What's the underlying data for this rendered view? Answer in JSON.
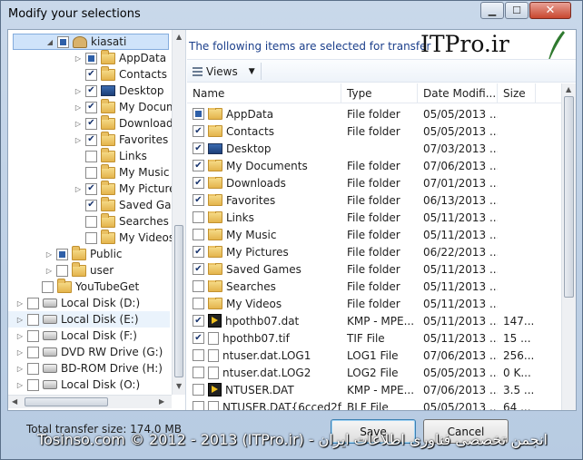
{
  "window": {
    "title": "Modify your selections"
  },
  "tree": {
    "items": [
      {
        "label": "kiasati",
        "check": "partial",
        "icon": "user",
        "arrow": "open",
        "indent": 1,
        "selected": true
      },
      {
        "label": "AppData",
        "check": "partial",
        "icon": "folder",
        "arrow": "closed",
        "indent": 2
      },
      {
        "label": "Contacts",
        "check": "checked",
        "icon": "folder",
        "arrow": "none",
        "indent": 2
      },
      {
        "label": "Desktop",
        "check": "checked",
        "icon": "monitor",
        "arrow": "closed",
        "indent": 2
      },
      {
        "label": "My Documents",
        "check": "checked",
        "icon": "folder",
        "arrow": "closed",
        "indent": 2
      },
      {
        "label": "Downloads",
        "check": "checked",
        "icon": "folder",
        "arrow": "closed",
        "indent": 2
      },
      {
        "label": "Favorites",
        "check": "checked",
        "icon": "folder",
        "arrow": "closed",
        "indent": 2
      },
      {
        "label": "Links",
        "check": "unchecked",
        "icon": "folder",
        "arrow": "none",
        "indent": 2
      },
      {
        "label": "My Music",
        "check": "unchecked",
        "icon": "folder",
        "arrow": "none",
        "indent": 2
      },
      {
        "label": "My Pictures",
        "check": "checked",
        "icon": "folder",
        "arrow": "closed",
        "indent": 2
      },
      {
        "label": "Saved Games",
        "check": "checked",
        "icon": "folder",
        "arrow": "none",
        "indent": 2
      },
      {
        "label": "Searches",
        "check": "unchecked",
        "icon": "folder",
        "arrow": "none",
        "indent": 2
      },
      {
        "label": "My Videos",
        "check": "unchecked",
        "icon": "folder",
        "arrow": "none",
        "indent": 2
      },
      {
        "label": "Public",
        "check": "partial",
        "icon": "folder",
        "arrow": "closed",
        "indent": 1
      },
      {
        "label": "user",
        "check": "unchecked",
        "icon": "folder",
        "arrow": "closed",
        "indent": 1
      },
      {
        "label": "YouTubeGet",
        "check": "unchecked",
        "icon": "folder",
        "arrow": "none",
        "indent": 0.5
      },
      {
        "label": "Local Disk (D:)",
        "check": "unchecked",
        "icon": "drive",
        "arrow": "closed",
        "indent": 0
      },
      {
        "label": "Local Disk (E:)",
        "check": "unchecked",
        "icon": "drive",
        "arrow": "closed",
        "indent": 0,
        "hover": true
      },
      {
        "label": "Local Disk (F:)",
        "check": "unchecked",
        "icon": "drive",
        "arrow": "closed",
        "indent": 0
      },
      {
        "label": "DVD RW Drive (G:)",
        "check": "unchecked",
        "icon": "drive",
        "arrow": "closed",
        "indent": 0
      },
      {
        "label": "BD-ROM Drive (H:)",
        "check": "unchecked",
        "icon": "drive",
        "arrow": "closed",
        "indent": 0
      },
      {
        "label": "Local Disk (O:)",
        "check": "unchecked",
        "icon": "drive",
        "arrow": "closed",
        "indent": 0
      }
    ]
  },
  "right": {
    "info_text": "The following items are selected for transfer",
    "logo_text": "ITPro.ir",
    "views_label": "Views",
    "columns": [
      "Name",
      "Type",
      "Date Modifi...",
      "Size"
    ],
    "rows": [
      {
        "name": "AppData",
        "type": "File folder",
        "date": "05/05/2013 ...",
        "size": "",
        "check": "partial",
        "icon": "folder"
      },
      {
        "name": "Contacts",
        "type": "File folder",
        "date": "05/05/2013 ...",
        "size": "",
        "check": "checked",
        "icon": "folder"
      },
      {
        "name": "Desktop",
        "type": "",
        "date": "07/03/2013 ...",
        "size": "",
        "check": "checked",
        "icon": "monitor"
      },
      {
        "name": "My Documents",
        "type": "File folder",
        "date": "07/06/2013 ...",
        "size": "",
        "check": "checked",
        "icon": "folder"
      },
      {
        "name": "Downloads",
        "type": "File folder",
        "date": "07/01/2013 ...",
        "size": "",
        "check": "checked",
        "icon": "folder"
      },
      {
        "name": "Favorites",
        "type": "File folder",
        "date": "06/13/2013 ...",
        "size": "",
        "check": "checked",
        "icon": "folder"
      },
      {
        "name": "Links",
        "type": "File folder",
        "date": "05/11/2013 ...",
        "size": "",
        "check": "unchecked",
        "icon": "folder"
      },
      {
        "name": "My Music",
        "type": "File folder",
        "date": "05/11/2013 ...",
        "size": "",
        "check": "unchecked",
        "icon": "folder"
      },
      {
        "name": "My Pictures",
        "type": "File folder",
        "date": "06/22/2013 ...",
        "size": "",
        "check": "checked",
        "icon": "folder"
      },
      {
        "name": "Saved Games",
        "type": "File folder",
        "date": "05/11/2013 ...",
        "size": "",
        "check": "checked",
        "icon": "folder"
      },
      {
        "name": "Searches",
        "type": "File folder",
        "date": "05/11/2013 ...",
        "size": "",
        "check": "unchecked",
        "icon": "folder"
      },
      {
        "name": "My Videos",
        "type": "File folder",
        "date": "05/11/2013 ...",
        "size": "",
        "check": "unchecked",
        "icon": "folder"
      },
      {
        "name": "hpothb07.dat",
        "type": "KMP - MPE...",
        "date": "05/11/2013 ...",
        "size": "147...",
        "check": "checked",
        "icon": "media"
      },
      {
        "name": "hpothb07.tif",
        "type": "TIF File",
        "date": "05/11/2013 ...",
        "size": "15 ...",
        "check": "checked",
        "icon": "file"
      },
      {
        "name": "ntuser.dat.LOG1",
        "type": "LOG1 File",
        "date": "07/06/2013 ...",
        "size": "256...",
        "check": "unchecked",
        "icon": "file"
      },
      {
        "name": "ntuser.dat.LOG2",
        "type": "LOG2 File",
        "date": "05/05/2013 ...",
        "size": "0 K...",
        "check": "unchecked",
        "icon": "file"
      },
      {
        "name": "NTUSER.DAT",
        "type": "KMP - MPE...",
        "date": "07/06/2013 ...",
        "size": "3.5 ...",
        "check": "unchecked",
        "icon": "media"
      },
      {
        "name": "NTUSER.DAT{6cced2f...",
        "type": "BLF File",
        "date": "05/05/2013 ...",
        "size": "64 ...",
        "check": "unchecked",
        "icon": "file"
      }
    ]
  },
  "footer": {
    "total_label": "Total transfer size: 174.0 MB",
    "save_label": "Save",
    "cancel_label": "Cancel"
  },
  "watermark": "Tosinso.com © 2012 - 2013 (ITPro.ir) - انجمن تخصصی فناوری اطلاعات ایران",
  "colors": {
    "accent": "#1b3f8b",
    "selection": "#cfe3fa",
    "title_bar": "#c9d8ea"
  }
}
